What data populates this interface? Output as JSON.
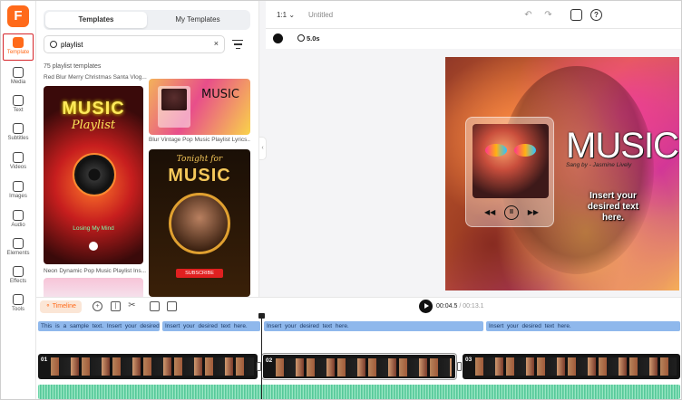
{
  "brand": {
    "logo_letter": "F",
    "accent": "#ff6a1a"
  },
  "rail": {
    "items": [
      {
        "label": "Template",
        "icon": "template-icon",
        "active": true
      },
      {
        "label": "Media",
        "icon": "media-icon"
      },
      {
        "label": "Text",
        "icon": "text-icon"
      },
      {
        "label": "Subtitles",
        "icon": "subtitles-icon"
      },
      {
        "label": "Videos",
        "icon": "videos-icon"
      },
      {
        "label": "Images",
        "icon": "images-icon"
      },
      {
        "label": "Audio",
        "icon": "audio-icon"
      },
      {
        "label": "Elements",
        "icon": "elements-icon"
      },
      {
        "label": "Effects",
        "icon": "effects-icon"
      },
      {
        "label": "Tools",
        "icon": "tools-icon"
      }
    ]
  },
  "panel": {
    "tabs": [
      "Templates",
      "My Templates"
    ],
    "search_value": "playlist",
    "clear_glyph": "×",
    "count_label": "75 playlist templates",
    "templates": [
      {
        "caption": "Red Blur Merry Christmas Santa Vlog...",
        "title": "MUSIC",
        "subtitle": "Playlist",
        "song": "Losing My Mind"
      },
      {
        "caption": "Blur Vintage Pop Music Playlist Lyrics...",
        "title": "MUSIC"
      },
      {
        "caption": "",
        "kicker": "Tonight for",
        "title": "MUSIC",
        "button": "SUBSCRIBE"
      },
      {
        "caption": "Neon Dynamic Pop Music Playlist Ins..."
      }
    ]
  },
  "topbar": {
    "ratio": "1:1",
    "title": "Untitled"
  },
  "subbar": {
    "duration": "5.0s",
    "color": "#111111"
  },
  "canvas": {
    "title": "MUSIC",
    "artist": "Sang by - Jasmine Lively",
    "text": "Insert your desired text here."
  },
  "timeline": {
    "label": "Timeline",
    "current": "00:04.5",
    "total": "/ 00:13.1",
    "text_clips": [
      "This is a sample text. Insert your desired...",
      "Insert your desired text here.",
      "Insert your desired text here.",
      "Insert your desired text here."
    ],
    "video_clips": [
      "01",
      "02",
      "03"
    ]
  }
}
